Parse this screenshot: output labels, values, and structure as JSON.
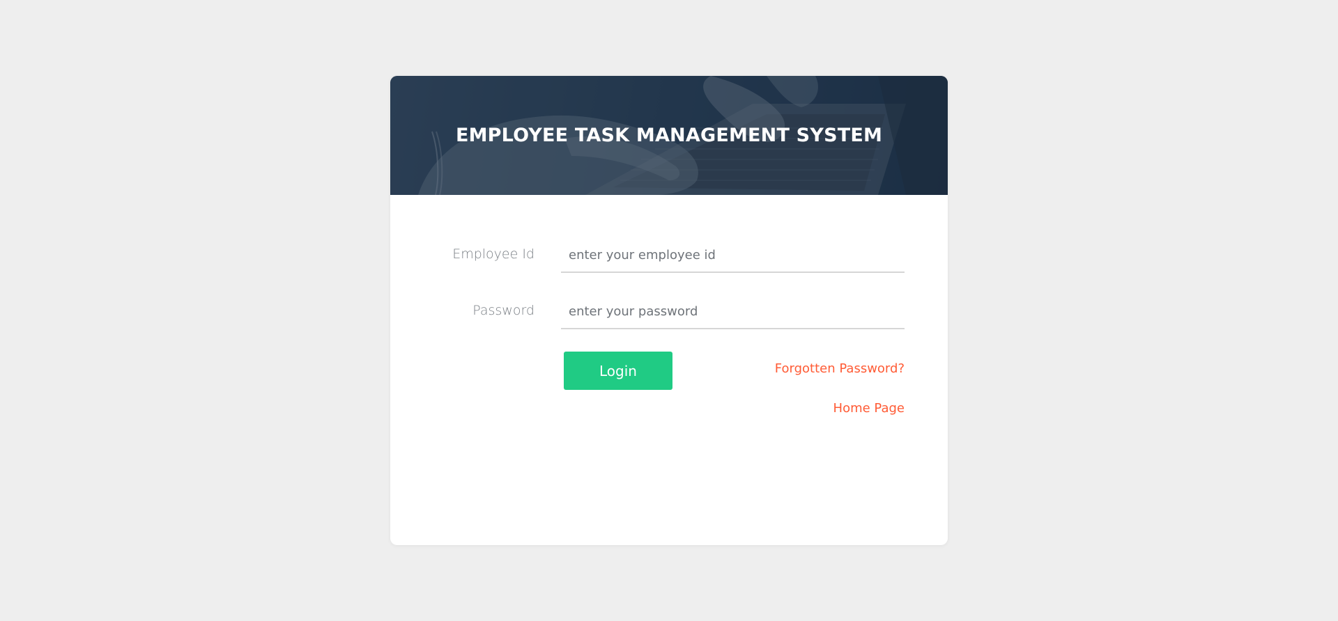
{
  "header": {
    "title": "EMPLOYEE TASK MANAGEMENT SYSTEM"
  },
  "form": {
    "employee_id": {
      "label": "Employee Id",
      "placeholder": "enter your employee id",
      "value": ""
    },
    "password": {
      "label": "Password",
      "placeholder": "enter your password",
      "value": ""
    },
    "login_label": "Login",
    "forgot_label": "Forgotten Password?",
    "home_label": "Home Page"
  },
  "colors": {
    "page_background": "#eeeeee",
    "banner_overlay": "#1a2d44",
    "primary_button": "#20cb84",
    "link": "#ff5b35",
    "label": "#7a7f85"
  }
}
